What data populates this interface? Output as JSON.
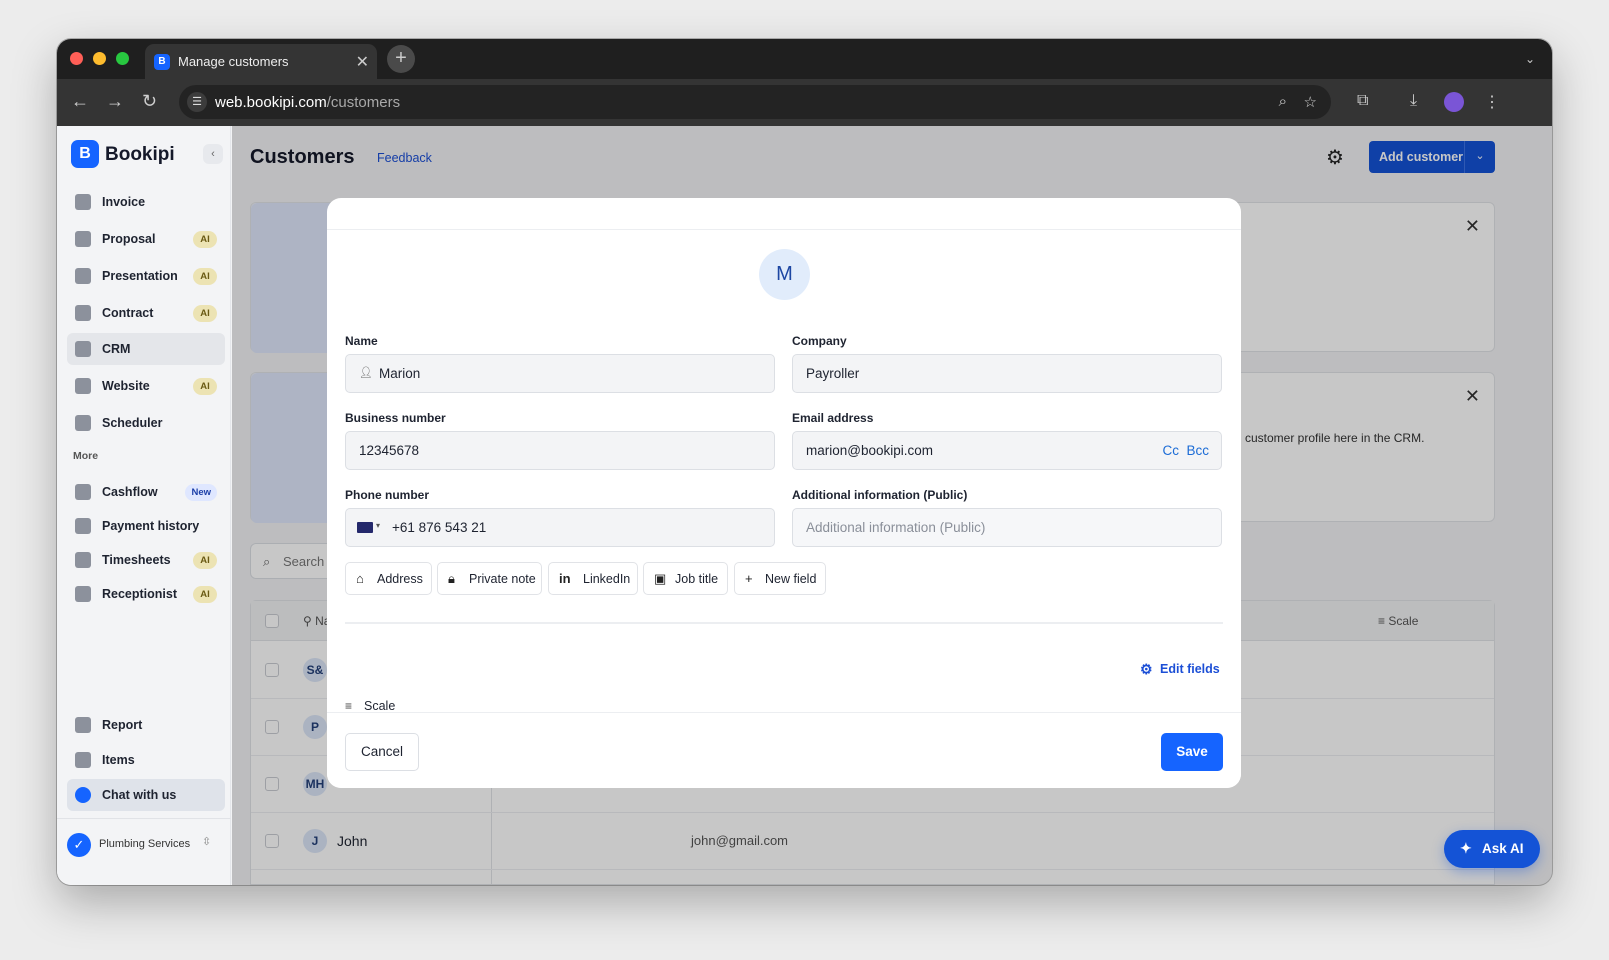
{
  "browser": {
    "tab_title": "Manage customers",
    "new_tab": "+",
    "url_host": "web.bookipi.com",
    "url_path": "/customers"
  },
  "sidebar": {
    "brand": "Bookipi",
    "items": [
      {
        "label": "Invoice",
        "badge": ""
      },
      {
        "label": "Proposal",
        "badge": "AI"
      },
      {
        "label": "Presentation",
        "badge": "AI"
      },
      {
        "label": "Contract",
        "badge": "AI"
      },
      {
        "label": "CRM",
        "badge": ""
      },
      {
        "label": "Website",
        "badge": "AI"
      },
      {
        "label": "Scheduler",
        "badge": ""
      }
    ],
    "more_label": "More",
    "more_items": [
      {
        "label": "Cashflow",
        "badge": "New"
      },
      {
        "label": "Payment history",
        "badge": ""
      },
      {
        "label": "Timesheets",
        "badge": "AI"
      },
      {
        "label": "Receptionist",
        "badge": "AI"
      }
    ],
    "bottom_items": [
      {
        "label": "Report"
      },
      {
        "label": "Items"
      },
      {
        "label": "Chat with us"
      }
    ],
    "workspace": "Plumbing Services"
  },
  "header": {
    "title": "Customers",
    "feedback": "Feedback",
    "add_customer": "Add customer"
  },
  "background": {
    "card_text": "customer profile here in the CRM.",
    "search_placeholder": "Search",
    "col_name": "Na",
    "col_scale": "Scale",
    "rows": [
      {
        "initials": "S&",
        "name": "",
        "email": ""
      },
      {
        "initials": "P",
        "name": "",
        "email": ""
      },
      {
        "initials": "MH",
        "name": "",
        "email": ""
      },
      {
        "initials": "J",
        "name": "John",
        "email": "john@gmail.com"
      }
    ]
  },
  "modal": {
    "avatar_initial": "M",
    "name_label": "Name",
    "name_value": "Marion",
    "company_label": "Company",
    "company_value": "Payroller",
    "business_label": "Business number",
    "business_value": "12345678",
    "email_label": "Email address",
    "email_value": "marion@bookipi.com",
    "cc_bcc": "Cc  Bcc",
    "phone_label": "Phone number",
    "phone_value": "+61 876 543 21",
    "additional_label": "Additional information (Public)",
    "additional_placeholder": "Additional information (Public)",
    "chips": [
      "Address",
      "Private note",
      "LinkedIn",
      "Job title",
      "New field"
    ],
    "edit_fields": "Edit fields",
    "scale": "Scale",
    "cancel": "Cancel",
    "save": "Save"
  },
  "ask_ai": "Ask AI",
  "colors": {
    "primary": "#1564ff",
    "button_blue": "#1453d6",
    "ai_badge": "#ece3b3"
  }
}
